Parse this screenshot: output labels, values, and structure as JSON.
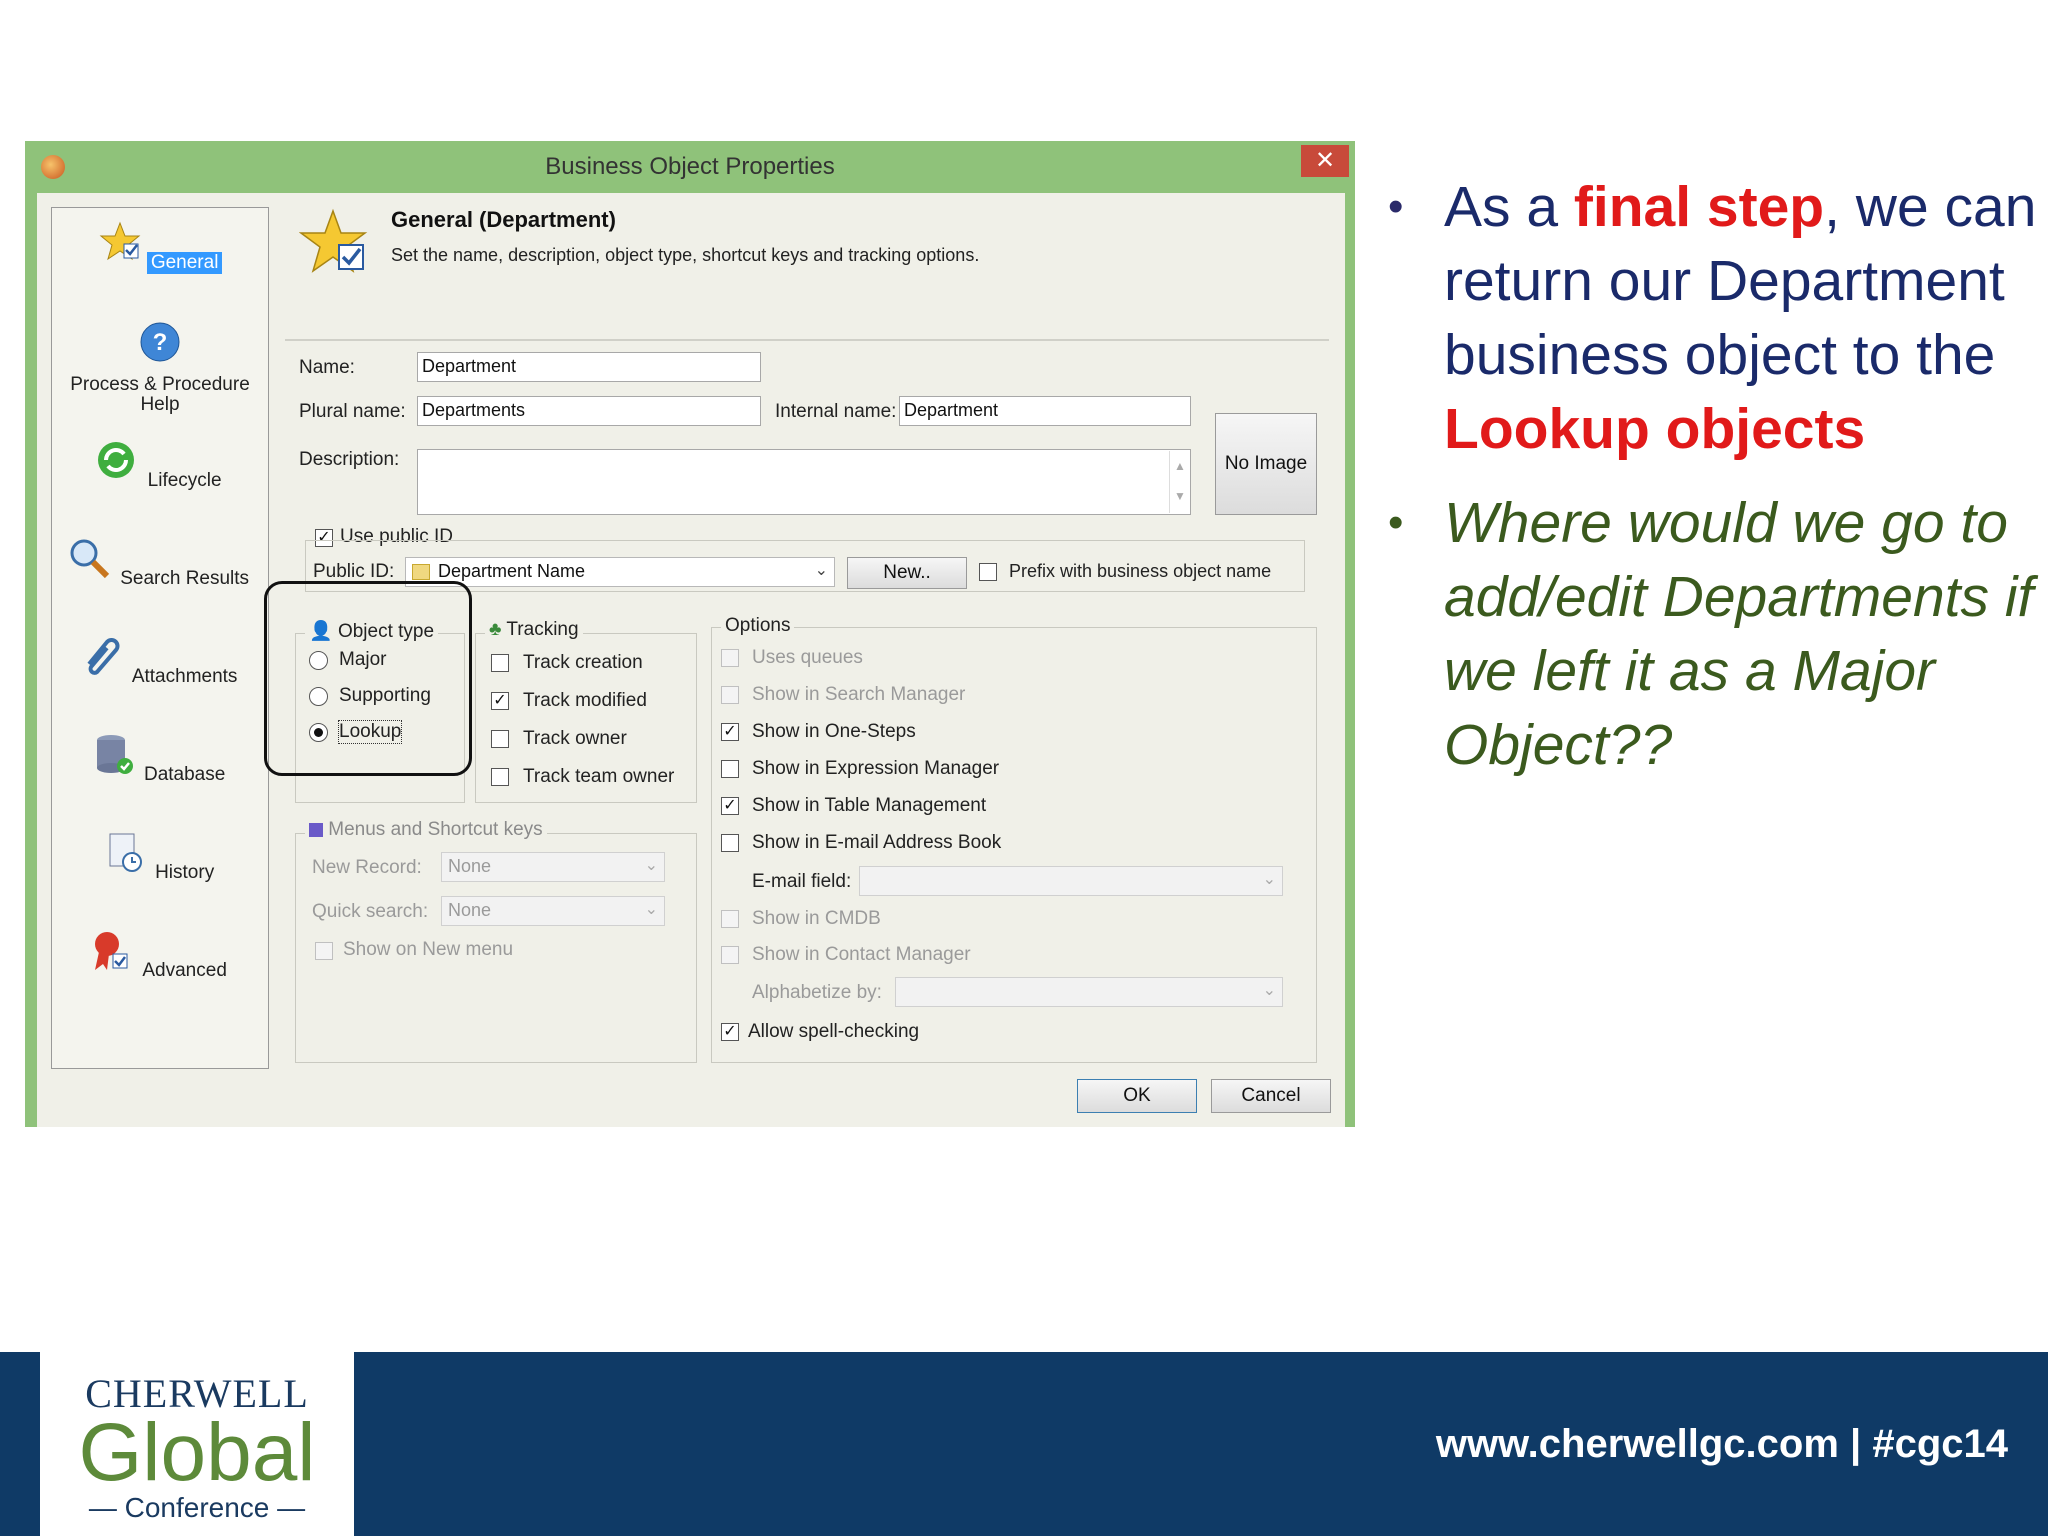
{
  "dialog": {
    "title": "Business Object Properties",
    "close_label": "✕",
    "nav": [
      {
        "label": "General",
        "icon": "star-check-icon",
        "selected": true
      },
      {
        "label": "Process & Procedure Help",
        "icon": "help-icon"
      },
      {
        "label": "Lifecycle",
        "icon": "recycle-icon"
      },
      {
        "label": "Search Results",
        "icon": "magnifier-icon"
      },
      {
        "label": "Attachments",
        "icon": "paperclip-icon"
      },
      {
        "label": "Database",
        "icon": "database-icon"
      },
      {
        "label": "History",
        "icon": "history-icon"
      },
      {
        "label": "Advanced",
        "icon": "ribbon-icon"
      }
    ],
    "header": {
      "title": "General  (Department)",
      "description": "Set the name, description, object type, shortcut keys and tracking options."
    },
    "fields": {
      "name_label": "Name:",
      "name_value": "Department",
      "plural_label": "Plural name:",
      "plural_value": "Departments",
      "internal_label": "Internal name:",
      "internal_value": "Department",
      "description_label": "Description:",
      "description_value": "",
      "no_image_label": "No Image",
      "use_public_id_label": "Use public ID",
      "use_public_id_checked": true,
      "public_id_label": "Public ID:",
      "public_id_value": "Department Name",
      "new_button": "New..",
      "prefix_label": "Prefix with business object name",
      "prefix_checked": false
    },
    "object_type": {
      "title": "Object type",
      "options": [
        {
          "label": "Major",
          "selected": false
        },
        {
          "label": "Supporting",
          "selected": false
        },
        {
          "label": "Lookup",
          "selected": true
        }
      ]
    },
    "tracking": {
      "title": "Tracking",
      "options": [
        {
          "label": "Track creation",
          "checked": false
        },
        {
          "label": "Track modified",
          "checked": true
        },
        {
          "label": "Track owner",
          "checked": false
        },
        {
          "label": "Track team owner",
          "checked": false
        }
      ]
    },
    "menus": {
      "title": "Menus and Shortcut keys",
      "new_record_label": "New Record:",
      "new_record_value": "None",
      "quick_search_label": "Quick search:",
      "quick_search_value": "None",
      "show_new_menu_label": "Show on New menu"
    },
    "options": {
      "title": "Options",
      "uses_queues": "Uses queues",
      "show_search_manager": "Show in Search Manager",
      "show_one_steps": "Show in One-Steps",
      "show_expression_manager": "Show in Expression Manager",
      "show_table_management": "Show in Table Management",
      "show_email_address_book": "Show in E-mail Address Book",
      "email_field_label": "E-mail field:",
      "show_cmdb": "Show in CMDB",
      "show_contact_manager": "Show in Contact Manager",
      "alphabetize_label": "Alphabetize by:",
      "allow_spell_checking": "Allow spell-checking"
    },
    "ok_button": "OK",
    "cancel_button": "Cancel"
  },
  "slide": {
    "bullet1_pre": "As a ",
    "bullet1_red1": "final step",
    "bullet1_mid": ", we can return our Department business object to the ",
    "bullet1_red2": "Lookup objects",
    "bullet2": "Where would we go to add/edit Departments if we left it as a Major Object??",
    "bullet_glyph": "•"
  },
  "footer": {
    "logo_line1": "CHERWELL",
    "logo_line2": "Global",
    "logo_line3": "— Conference —",
    "url": "www.cherwellgc.com | #cgc14"
  },
  "colors": {
    "titlebar": "#8fc27a",
    "close": "#c84a3a",
    "footer": "#0f3a66",
    "accent_red": "#e11a1a",
    "navy_text": "#1a2a6a",
    "green_text": "#3b5a1e"
  }
}
